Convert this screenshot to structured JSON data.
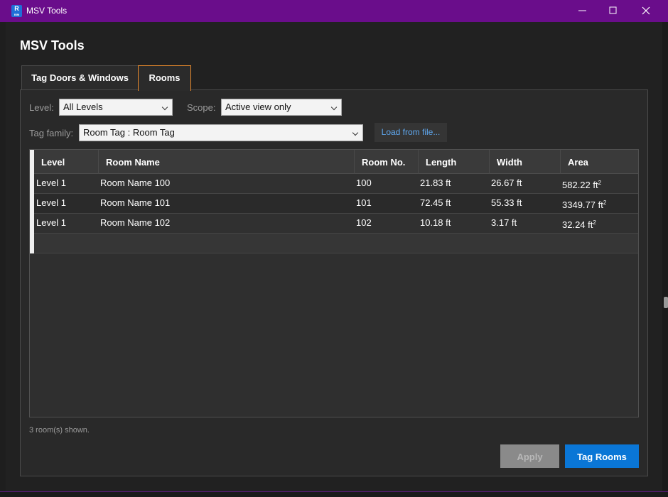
{
  "window": {
    "title": "MSV Tools",
    "app_icon": {
      "letter": "R",
      "sub": "BIM"
    }
  },
  "heading": "MSV Tools",
  "tabs": [
    {
      "label": "Tag Doors & Windows",
      "active": false
    },
    {
      "label": "Rooms",
      "active": true
    }
  ],
  "filters": {
    "level_label": "Level:",
    "level_value": "All Levels",
    "scope_label": "Scope:",
    "scope_value": "Active view only",
    "tag_family_label": "Tag family:",
    "tag_family_value": "Room Tag : Room Tag",
    "load_button": "Load from file..."
  },
  "table": {
    "columns": [
      "Level",
      "Room Name",
      "Room No.",
      "Length",
      "Width",
      "Area"
    ],
    "rows": [
      {
        "level": "Level 1",
        "name": "Room Name 100",
        "number": "100",
        "length": "21.83 ft",
        "width": "26.67 ft",
        "area": "582.22 ft",
        "area_unit_sup": "2"
      },
      {
        "level": "Level 1",
        "name": "Room Name 101",
        "number": "101",
        "length": "72.45 ft",
        "width": "55.33 ft",
        "area": "3349.77 ft",
        "area_unit_sup": "2"
      },
      {
        "level": "Level 1",
        "name": "Room Name 102",
        "number": "102",
        "length": "10.18 ft",
        "width": "3.17 ft",
        "area": "32.24 ft",
        "area_unit_sup": "2"
      }
    ]
  },
  "status": "3 room(s) shown.",
  "buttons": {
    "apply": "Apply",
    "tag_rooms": "Tag Rooms"
  },
  "colors": {
    "titlebar": "#6a0d8b",
    "accent_tab": "#e88a2c",
    "primary_button": "#0a76d6",
    "link": "#5fa8f0"
  }
}
